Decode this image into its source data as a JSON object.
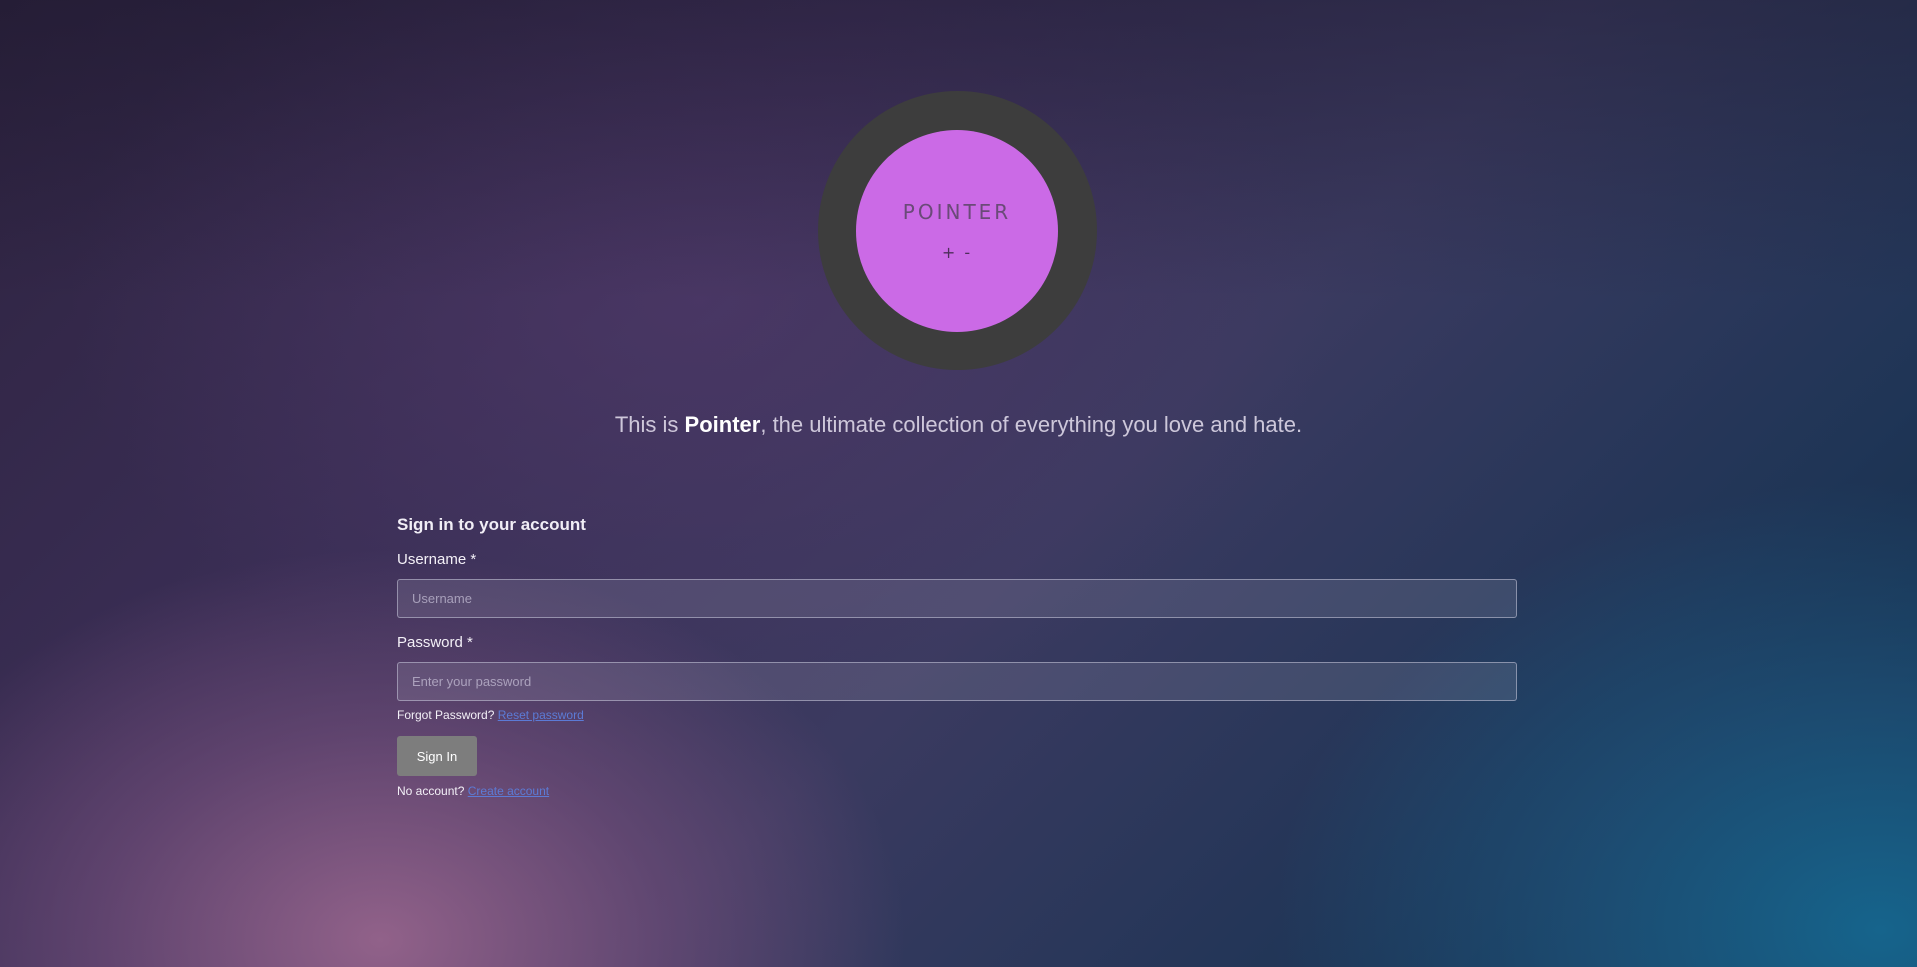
{
  "logo": {
    "title": "POINTER",
    "subtitle": "+ -"
  },
  "tagline": {
    "prefix": "This is ",
    "brand": "Pointer",
    "suffix": ", the ultimate collection of everything you love and hate."
  },
  "form": {
    "heading": "Sign in to your account",
    "username": {
      "label": "Username",
      "required_mark": "*",
      "placeholder": "Username",
      "value": ""
    },
    "password": {
      "label": "Password",
      "required_mark": "*",
      "placeholder": "Enter your password",
      "value": ""
    },
    "forgot": {
      "text": "Forgot Password?",
      "link": "Reset password"
    },
    "submit_label": "Sign In",
    "register": {
      "text": "No account?",
      "link": "Create account"
    }
  },
  "colors": {
    "logo_outer": "#3d3d3d",
    "logo_inner": "#cb6ae6",
    "link": "#5c7bd6",
    "button": "#7d7d7d"
  }
}
